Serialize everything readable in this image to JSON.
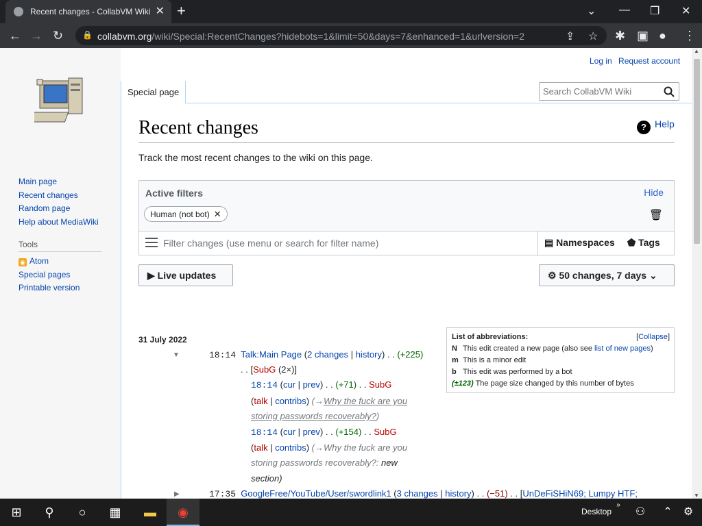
{
  "browser": {
    "tab_title": "Recent changes - CollabVM Wiki",
    "tab_close": "✕",
    "new_tab": "+",
    "url_host": "collabvm.org",
    "url_path": "/wiki/Special:RecentChanges?hidebots=1&limit=50&days=7&enhanced=1&urlversion=2"
  },
  "personal": {
    "login": "Log in",
    "request": "Request account"
  },
  "sidebar": {
    "nav": [
      "Main page",
      "Recent changes",
      "Random page",
      "Help about MediaWiki"
    ],
    "tools_heading": "Tools",
    "tools": [
      "Atom",
      "Special pages",
      "Printable version"
    ]
  },
  "tabs": {
    "special": "Special page"
  },
  "search": {
    "placeholder": "Search CollabVM Wiki"
  },
  "page": {
    "title": "Recent changes",
    "help": "Help",
    "intro": "Track the most recent changes to the wiki on this page."
  },
  "filters": {
    "title": "Active filters",
    "hide": "Hide",
    "chip": "Human (not bot)",
    "placeholder": "Filter changes (use menu or search for filter name)",
    "namespaces": "Namespaces",
    "tags": "Tags"
  },
  "buttons": {
    "live": "Live updates",
    "changes": "50 changes, 7 days"
  },
  "date": "31 July 2022",
  "abbr": {
    "title": "List of abbreviations:",
    "collapse": "Collapse",
    "n_key": "N",
    "n_text": "This edit created a new page (also see ",
    "n_link": "list of new pages",
    "n_end": ")",
    "m_key": "m",
    "m_text": "This is a minor edit",
    "b_key": "b",
    "b_text": "This edit was performed by a bot",
    "s_key": "(±123)",
    "s_text": "The page size changed by this number of bytes"
  },
  "entries": {
    "g1_time": "18:14",
    "g1_page": "Talk:Main Page",
    "g1_changes": "2 changes",
    "g1_history": "history",
    "g1_size": "(+225)",
    "g1_user": "SubG",
    "g1_count": "(2×)",
    "e1_time": "18:14",
    "e1_cur": "cur",
    "e1_prev": "prev",
    "e1_size": "(+71)",
    "e1_user": "SubG",
    "e1_talk": "talk",
    "e1_contribs": "contribs",
    "e1_comment_1": "Why the fuck are you",
    "e1_comment_2": "storing passwords recoverably?",
    "e2_time": "18:14",
    "e2_cur": "cur",
    "e2_prev": "prev",
    "e2_size": "(+154)",
    "e2_user": "SubG",
    "e2_talk": "talk",
    "e2_contribs": "contribs",
    "e2_comment_1": "Why the fuck are you",
    "e2_comment_2": "storing passwords recoverably?:",
    "e2_comment_new": "new",
    "e2_comment_3": "section",
    "g2_time": "17:35",
    "g2_page": "GoogleFree/YouTube/User/swordlink1",
    "g2_changes": "3 changes",
    "g2_history": "history",
    "g2_size": "(−51)",
    "g2_users": "UnDeFiSHiN69; Lumpy HTF;"
  },
  "taskbar": {
    "desktop": "Desktop"
  }
}
